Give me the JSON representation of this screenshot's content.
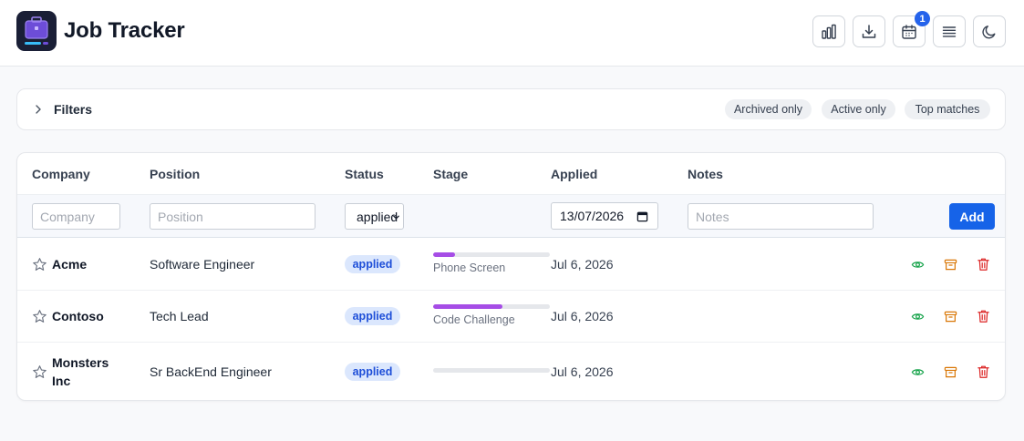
{
  "app": {
    "title": "Job Tracker"
  },
  "header": {
    "buttons": [
      {
        "name": "stats",
        "icon": "bar-chart-icon"
      },
      {
        "name": "export",
        "icon": "download-icon"
      },
      {
        "name": "calendar",
        "icon": "calendar-icon",
        "badge": "1"
      },
      {
        "name": "density",
        "icon": "list-icon"
      },
      {
        "name": "theme",
        "icon": "moon-icon"
      }
    ]
  },
  "filters": {
    "label": "Filters",
    "chips": [
      "Archived only",
      "Active only",
      "Top matches"
    ]
  },
  "table": {
    "columns": [
      "Company",
      "Position",
      "Status",
      "Stage",
      "Applied",
      "Notes"
    ],
    "new_row": {
      "company_placeholder": "Company",
      "position_placeholder": "Position",
      "status_value": "applied",
      "date_value": "13/07/2026",
      "notes_placeholder": "Notes",
      "add_label": "Add"
    },
    "rows": [
      {
        "company": "Acme",
        "position": "Software Engineer",
        "status": "applied",
        "stage": "Phone Screen",
        "stage_progress": 0.19,
        "applied": "Jul 6, 2026"
      },
      {
        "company": "Contoso",
        "position": "Tech Lead",
        "status": "applied",
        "stage": "Code Challenge",
        "stage_progress": 0.59,
        "applied": "Jul 6, 2026"
      },
      {
        "company": "Monsters Inc",
        "position": "Sr BackEnd Engineer",
        "status": "applied",
        "stage": "",
        "stage_progress": 0,
        "applied": "Jul 6, 2026"
      }
    ]
  },
  "colors": {
    "accent": "#1663e8",
    "stage_fill": "#a64de6",
    "status_bg": "#dbe7fd",
    "status_text": "#1d4ed8",
    "view_icon": "#16a34a",
    "archive_icon": "#d97706",
    "delete_icon": "#dc2626"
  }
}
